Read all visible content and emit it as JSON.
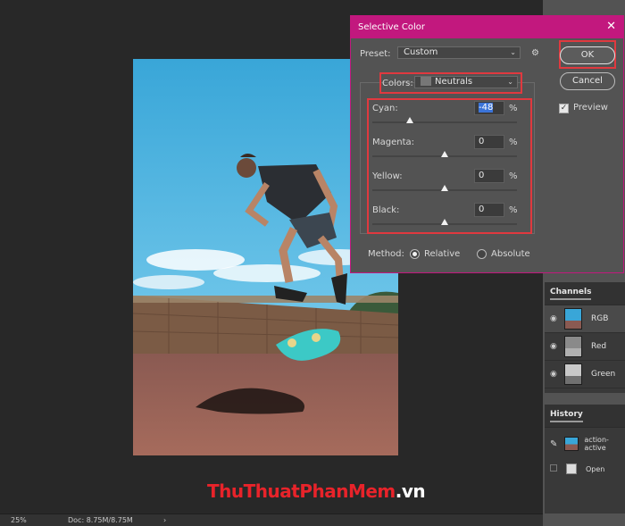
{
  "dialog": {
    "title": "Selective Color",
    "preset_label": "Preset:",
    "preset_value": "Custom",
    "colors_label": "Colors:",
    "colors_value": "Neutrals",
    "sliders": [
      {
        "label": "Cyan:",
        "value": "-48",
        "unit": "%",
        "level": -0.48
      },
      {
        "label": "Magenta:",
        "value": "0",
        "unit": "%",
        "level": 0
      },
      {
        "label": "Yellow:",
        "value": "0",
        "unit": "%",
        "level": 0
      },
      {
        "label": "Black:",
        "value": "0",
        "unit": "%",
        "level": 0
      }
    ],
    "method_label": "Method:",
    "method_relative": "Relative",
    "method_absolute": "Absolute",
    "method_selected": "Relative",
    "ok_label": "OK",
    "cancel_label": "Cancel",
    "preview_label": "Preview",
    "preview_checked": true,
    "title_color": "#c2187e",
    "highlight_color": "#e0393f"
  },
  "channels": {
    "title": "Channels",
    "items": [
      "RGB",
      "Red",
      "Green"
    ]
  },
  "history": {
    "title": "History",
    "items": [
      "action-active",
      "Open"
    ]
  },
  "status": {
    "zoom": "25%",
    "doc": "Doc: 8.75M/8.75M"
  },
  "watermark": {
    "part1": "Thu",
    "part2": "Thuat",
    "part3": "Phan",
    "part4": "Mem",
    "part5": ".vn"
  }
}
